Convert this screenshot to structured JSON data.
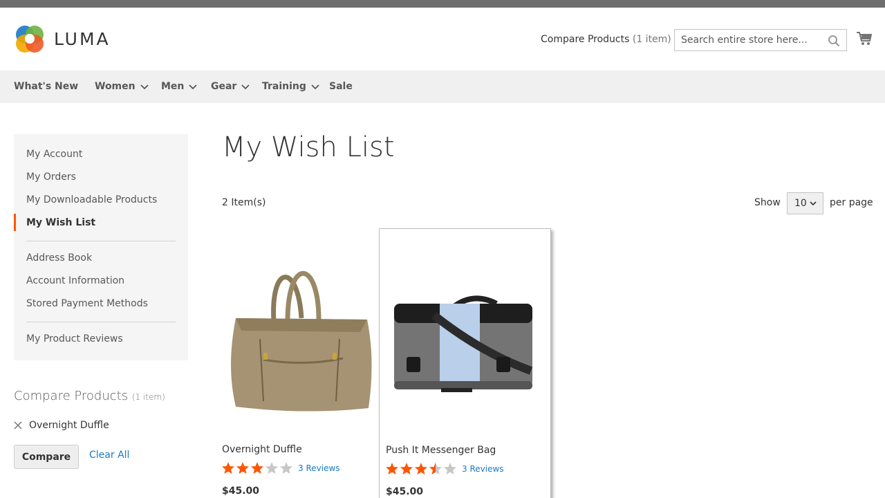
{
  "brand": {
    "name": "LUMA"
  },
  "header": {
    "compare_label": "Compare Products",
    "compare_count": "(1 item)",
    "search_placeholder": "Search entire store here..."
  },
  "nav": {
    "items": [
      {
        "label": "What's New",
        "dropdown": false
      },
      {
        "label": "Women",
        "dropdown": true
      },
      {
        "label": "Men",
        "dropdown": true
      },
      {
        "label": "Gear",
        "dropdown": true
      },
      {
        "label": "Training",
        "dropdown": true
      },
      {
        "label": "Sale",
        "dropdown": false
      }
    ]
  },
  "sidebar": {
    "items": [
      {
        "label": "My Account"
      },
      {
        "label": "My Orders"
      },
      {
        "label": "My Downloadable Products"
      },
      {
        "label": "My Wish List",
        "active": true
      },
      {
        "label": "Address Book"
      },
      {
        "label": "Account Information"
      },
      {
        "label": "Stored Payment Methods"
      },
      {
        "label": "My Product Reviews"
      }
    ]
  },
  "compare_block": {
    "title": "Compare Products",
    "count": "(1 item)",
    "items": [
      "Overnight Duffle"
    ],
    "compare_button": "Compare",
    "clear_all": "Clear All"
  },
  "main": {
    "title": "My Wish List",
    "item_count": "2 Item(s)",
    "limiter": {
      "show_label": "Show",
      "value": "10",
      "per_page_label": "per page"
    },
    "products": [
      {
        "name": "Overnight Duffle",
        "rating_stars": 3,
        "reviews": "3 Reviews",
        "price": "$45.00"
      },
      {
        "name": "Push It Messenger Bag",
        "rating_stars": 3.5,
        "reviews": "3 Reviews",
        "price": "$45.00"
      }
    ]
  },
  "colors": {
    "accent": "#ff5501",
    "link": "#1979c3",
    "nav_bg": "#f0f0f0",
    "sidebar_bg": "#f5f5f5",
    "star_empty": "#c7c7c7"
  }
}
